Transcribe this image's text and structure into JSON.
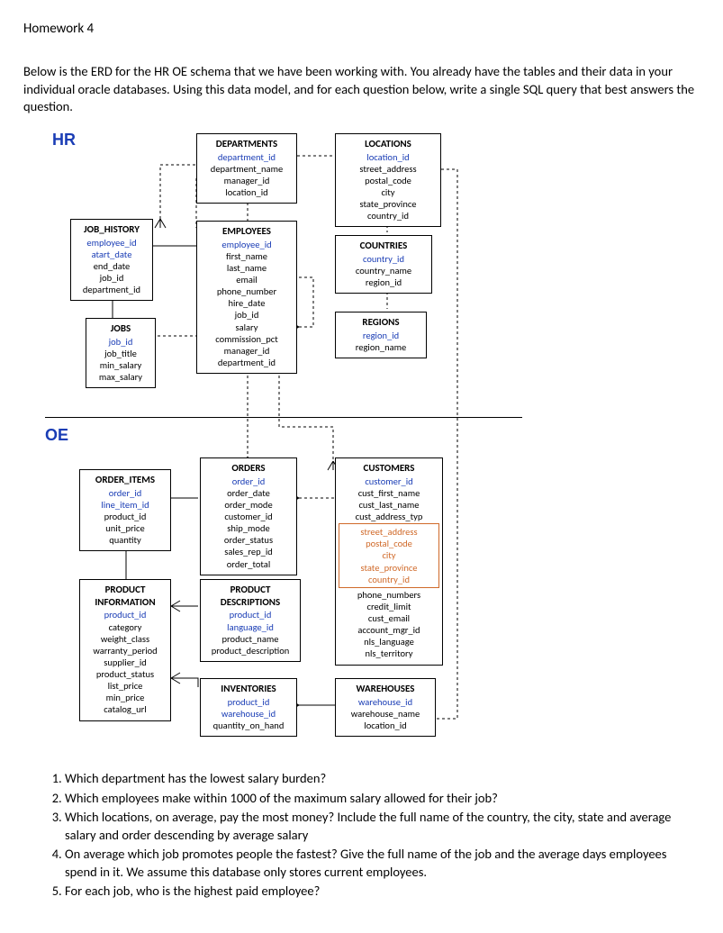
{
  "title": "Homework 4",
  "intro": "Below is the ERD for the HR OE schema that we have been working with. You already have the tables and their data in your individual oracle databases. Using this data model, and for each question below, write a single SQL query that best answers the question.",
  "schemas": {
    "hr": "HR",
    "oe": "OE"
  },
  "entities": {
    "departments": {
      "title": "DEPARTMENTS",
      "fields": [
        "department_id",
        "department_name",
        "manager_id",
        "location_id"
      ],
      "pk": [
        "department_id"
      ]
    },
    "locations": {
      "title": "LOCATIONS",
      "fields": [
        "location_id",
        "street_address",
        "postal_code",
        "city",
        "state_province",
        "country_id"
      ],
      "pk": [
        "location_id"
      ]
    },
    "job_history": {
      "title": "JOB_HISTORY",
      "fields": [
        "employee_id",
        "atart_date",
        "end_date",
        "job_id",
        "department_id"
      ],
      "pk": [
        "employee_id",
        "atart_date"
      ]
    },
    "employees": {
      "title": "EMPLOYEES",
      "fields": [
        "employee_id",
        "first_name",
        "last_name",
        "email",
        "phone_number",
        "hire_date",
        "job_id",
        "salary",
        "commission_pct",
        "manager_id",
        "department_id"
      ],
      "pk": [
        "employee_id"
      ]
    },
    "countries": {
      "title": "COUNTRIES",
      "fields": [
        "country_id",
        "country_name",
        "region_id"
      ],
      "pk": [
        "country_id"
      ]
    },
    "jobs": {
      "title": "JOBS",
      "fields": [
        "job_id",
        "job_title",
        "min_salary",
        "max_salary"
      ],
      "pk": [
        "job_id"
      ]
    },
    "regions": {
      "title": "REGIONS",
      "fields": [
        "region_id",
        "region_name"
      ],
      "pk": [
        "region_id"
      ]
    },
    "orders": {
      "title": "ORDERS",
      "fields": [
        "order_id",
        "order_date",
        "order_mode",
        "customer_id",
        "ship_mode",
        "order_status",
        "sales_rep_id",
        "order_total"
      ],
      "pk": [
        "order_id"
      ]
    },
    "customers": {
      "title": "CUSTOMERS",
      "fields": [
        "customer_id",
        "cust_first_name",
        "cust_last_name",
        "cust_address_typ"
      ],
      "pk": [
        "customer_id"
      ],
      "subtype": [
        "street_address",
        "postal_code",
        "city",
        "state_province",
        "country_id"
      ],
      "fields2": [
        "phone_numbers",
        "credit_limit",
        "cust_email",
        "account_mgr_id",
        "nls_language",
        "nls_territory"
      ]
    },
    "order_items": {
      "title": "ORDER_ITEMS",
      "fields": [
        "order_id",
        "line_item_id",
        "product_id",
        "unit_price",
        "quantity"
      ],
      "pk": [
        "order_id",
        "line_item_id"
      ]
    },
    "product_information": {
      "title": "PRODUCT INFORMATION",
      "fields": [
        "product_id",
        "category",
        "weight_class",
        "warranty_period",
        "supplier_id",
        "product_status",
        "list_price",
        "min_price",
        "catalog_url"
      ],
      "pk": [
        "product_id"
      ]
    },
    "product_descriptions": {
      "title": "PRODUCT DESCRIPTIONS",
      "fields": [
        "product_id",
        "language_id",
        "product_name",
        "product_description"
      ],
      "pk": [
        "product_id",
        "language_id"
      ]
    },
    "inventories": {
      "title": "INVENTORIES",
      "fields": [
        "product_id",
        "warehouse_id",
        "quantity_on_hand"
      ],
      "pk": [
        "product_id",
        "warehouse_id"
      ]
    },
    "warehouses": {
      "title": "WAREHOUSES",
      "fields": [
        "warehouse_id",
        "warehouse_name",
        "location_id"
      ],
      "pk": [
        "warehouse_id"
      ]
    }
  },
  "questions": [
    "Which department has the lowest salary burden?",
    "Which employees make within 1000 of the maximum salary allowed for their job?",
    "Which locations, on average, pay the most money? Include the full name of the country, the city, state and average salary and order descending by average salary",
    "On average which job promotes people the fastest? Give the full name of the job and the average days employees spend in it. We assume this database only stores current employees.",
    "For each job, who is the highest paid employee?"
  ]
}
